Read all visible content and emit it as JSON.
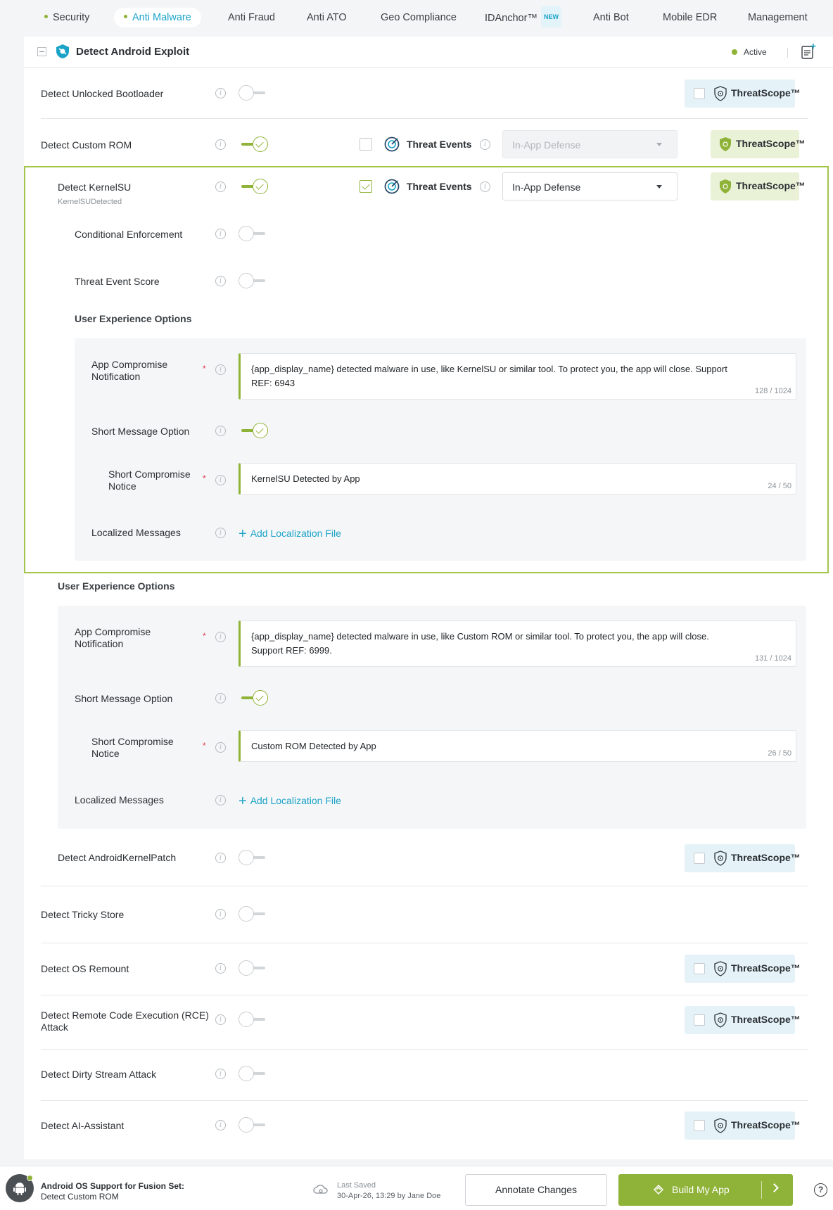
{
  "tabs": [
    {
      "label": "Security",
      "dot": true
    },
    {
      "label": "Anti Malware",
      "dot": true,
      "active": true
    },
    {
      "label": "Anti Fraud"
    },
    {
      "label": "Anti ATO"
    },
    {
      "label": "Geo Compliance"
    },
    {
      "label": "IDAnchor™",
      "badge": "NEW"
    },
    {
      "label": "Anti Bot"
    },
    {
      "label": "Mobile EDR"
    },
    {
      "label": "Management"
    }
  ],
  "panel": {
    "title": "Detect Android Exploit",
    "status": "Active",
    "icon": "shield-bug-icon"
  },
  "threatscope_label": "ThreatScope™",
  "threat_events_label": "Threat Events",
  "rows": {
    "unlocked_bootloader": {
      "label": "Detect Unlocked Bootloader",
      "enabled": false
    },
    "custom_rom": {
      "label": "Detect Custom ROM",
      "enabled": true,
      "threat_events_checked": false,
      "defense": "In-App Defense"
    },
    "kernelsu": {
      "label": "Detect KernelSU",
      "sublabel": "KernelSUDetected",
      "enabled": true,
      "threat_events_checked": true,
      "defense": "In-App Defense"
    },
    "conditional_enforcement": {
      "label": "Conditional Enforcement",
      "enabled": false
    },
    "threat_event_score": {
      "label": "Threat Event Score",
      "enabled": false
    },
    "android_kernel_patch": {
      "label": "Detect AndroidKernelPatch",
      "enabled": false
    },
    "tricky_store": {
      "label": "Detect Tricky Store",
      "enabled": false
    },
    "os_remount": {
      "label": "Detect OS Remount",
      "enabled": false
    },
    "rce": {
      "label": "Detect Remote Code Execution (RCE) Attack",
      "enabled": false
    },
    "dirty_stream": {
      "label": "Detect Dirty Stream Attack",
      "enabled": false
    },
    "ai_assistant": {
      "label": "Detect AI-Assistant",
      "enabled": false
    }
  },
  "ux_kernelsu": {
    "header": "User Experience Options",
    "app_notification_label": "App Compromise Notification",
    "app_notification_text": "{app_display_name} detected malware in use, like KernelSU or similar tool. To protect you, the app will close. Support REF: 6943",
    "app_notification_count": "128 / 1024",
    "short_option_label": "Short Message Option",
    "short_option_enabled": true,
    "short_notice_label": "Short Compromise Notice",
    "short_notice_text": "KernelSU Detected by App",
    "short_notice_count": "24 / 50",
    "localized_label": "Localized Messages",
    "add_localization": "Add Localization File"
  },
  "ux_custom_rom": {
    "header": "User Experience Options",
    "app_notification_label": "App Compromise Notification",
    "app_notification_text": "{app_display_name} detected malware in use, like Custom ROM or similar tool. To protect you, the app will close. Support REF: 6999.",
    "app_notification_count": "131 / 1024",
    "short_option_label": "Short Message Option",
    "short_option_enabled": true,
    "short_notice_label": "Short Compromise Notice",
    "short_notice_text": "Custom ROM Detected by App",
    "short_notice_count": "26 / 50",
    "localized_label": "Localized Messages",
    "add_localization": "Add Localization File"
  },
  "bottom": {
    "title": "Android OS Support for Fusion Set:",
    "subtitle": "Detect Custom ROM",
    "last_saved_label": "Last Saved",
    "last_saved_value": "30-Apr-26, 13:29 by Jane Doe",
    "annotate_label": "Annotate Changes",
    "build_label": "Build My App",
    "help_label": "?"
  },
  "colors": {
    "accent_green": "#8fb339",
    "accent_blue": "#1aa3c7",
    "required": "#e0344a"
  }
}
